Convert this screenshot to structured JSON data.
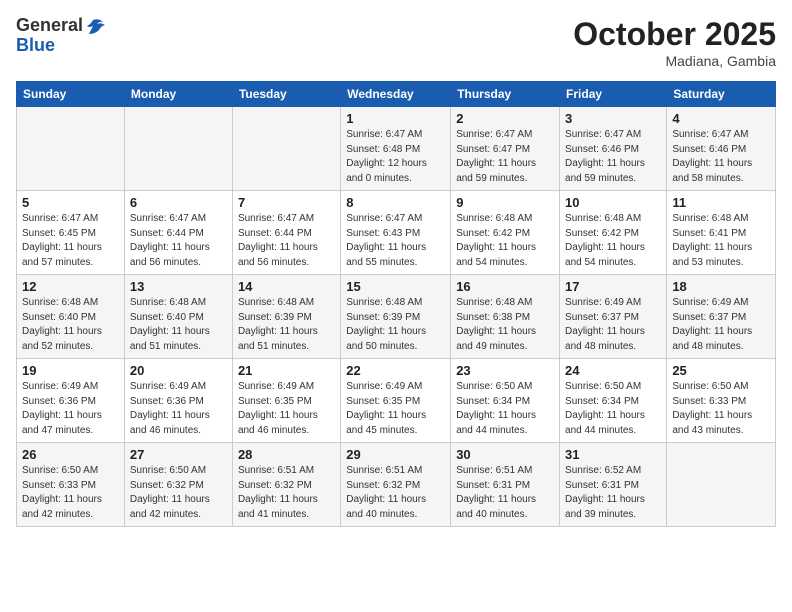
{
  "header": {
    "logo_general": "General",
    "logo_blue": "Blue",
    "month": "October 2025",
    "location": "Madiana, Gambia"
  },
  "days_of_week": [
    "Sunday",
    "Monday",
    "Tuesday",
    "Wednesday",
    "Thursday",
    "Friday",
    "Saturday"
  ],
  "weeks": [
    [
      {
        "day": "",
        "info": ""
      },
      {
        "day": "",
        "info": ""
      },
      {
        "day": "",
        "info": ""
      },
      {
        "day": "1",
        "info": "Sunrise: 6:47 AM\nSunset: 6:48 PM\nDaylight: 12 hours\nand 0 minutes."
      },
      {
        "day": "2",
        "info": "Sunrise: 6:47 AM\nSunset: 6:47 PM\nDaylight: 11 hours\nand 59 minutes."
      },
      {
        "day": "3",
        "info": "Sunrise: 6:47 AM\nSunset: 6:46 PM\nDaylight: 11 hours\nand 59 minutes."
      },
      {
        "day": "4",
        "info": "Sunrise: 6:47 AM\nSunset: 6:46 PM\nDaylight: 11 hours\nand 58 minutes."
      }
    ],
    [
      {
        "day": "5",
        "info": "Sunrise: 6:47 AM\nSunset: 6:45 PM\nDaylight: 11 hours\nand 57 minutes."
      },
      {
        "day": "6",
        "info": "Sunrise: 6:47 AM\nSunset: 6:44 PM\nDaylight: 11 hours\nand 56 minutes."
      },
      {
        "day": "7",
        "info": "Sunrise: 6:47 AM\nSunset: 6:44 PM\nDaylight: 11 hours\nand 56 minutes."
      },
      {
        "day": "8",
        "info": "Sunrise: 6:47 AM\nSunset: 6:43 PM\nDaylight: 11 hours\nand 55 minutes."
      },
      {
        "day": "9",
        "info": "Sunrise: 6:48 AM\nSunset: 6:42 PM\nDaylight: 11 hours\nand 54 minutes."
      },
      {
        "day": "10",
        "info": "Sunrise: 6:48 AM\nSunset: 6:42 PM\nDaylight: 11 hours\nand 54 minutes."
      },
      {
        "day": "11",
        "info": "Sunrise: 6:48 AM\nSunset: 6:41 PM\nDaylight: 11 hours\nand 53 minutes."
      }
    ],
    [
      {
        "day": "12",
        "info": "Sunrise: 6:48 AM\nSunset: 6:40 PM\nDaylight: 11 hours\nand 52 minutes."
      },
      {
        "day": "13",
        "info": "Sunrise: 6:48 AM\nSunset: 6:40 PM\nDaylight: 11 hours\nand 51 minutes."
      },
      {
        "day": "14",
        "info": "Sunrise: 6:48 AM\nSunset: 6:39 PM\nDaylight: 11 hours\nand 51 minutes."
      },
      {
        "day": "15",
        "info": "Sunrise: 6:48 AM\nSunset: 6:39 PM\nDaylight: 11 hours\nand 50 minutes."
      },
      {
        "day": "16",
        "info": "Sunrise: 6:48 AM\nSunset: 6:38 PM\nDaylight: 11 hours\nand 49 minutes."
      },
      {
        "day": "17",
        "info": "Sunrise: 6:49 AM\nSunset: 6:37 PM\nDaylight: 11 hours\nand 48 minutes."
      },
      {
        "day": "18",
        "info": "Sunrise: 6:49 AM\nSunset: 6:37 PM\nDaylight: 11 hours\nand 48 minutes."
      }
    ],
    [
      {
        "day": "19",
        "info": "Sunrise: 6:49 AM\nSunset: 6:36 PM\nDaylight: 11 hours\nand 47 minutes."
      },
      {
        "day": "20",
        "info": "Sunrise: 6:49 AM\nSunset: 6:36 PM\nDaylight: 11 hours\nand 46 minutes."
      },
      {
        "day": "21",
        "info": "Sunrise: 6:49 AM\nSunset: 6:35 PM\nDaylight: 11 hours\nand 46 minutes."
      },
      {
        "day": "22",
        "info": "Sunrise: 6:49 AM\nSunset: 6:35 PM\nDaylight: 11 hours\nand 45 minutes."
      },
      {
        "day": "23",
        "info": "Sunrise: 6:50 AM\nSunset: 6:34 PM\nDaylight: 11 hours\nand 44 minutes."
      },
      {
        "day": "24",
        "info": "Sunrise: 6:50 AM\nSunset: 6:34 PM\nDaylight: 11 hours\nand 44 minutes."
      },
      {
        "day": "25",
        "info": "Sunrise: 6:50 AM\nSunset: 6:33 PM\nDaylight: 11 hours\nand 43 minutes."
      }
    ],
    [
      {
        "day": "26",
        "info": "Sunrise: 6:50 AM\nSunset: 6:33 PM\nDaylight: 11 hours\nand 42 minutes."
      },
      {
        "day": "27",
        "info": "Sunrise: 6:50 AM\nSunset: 6:32 PM\nDaylight: 11 hours\nand 42 minutes."
      },
      {
        "day": "28",
        "info": "Sunrise: 6:51 AM\nSunset: 6:32 PM\nDaylight: 11 hours\nand 41 minutes."
      },
      {
        "day": "29",
        "info": "Sunrise: 6:51 AM\nSunset: 6:32 PM\nDaylight: 11 hours\nand 40 minutes."
      },
      {
        "day": "30",
        "info": "Sunrise: 6:51 AM\nSunset: 6:31 PM\nDaylight: 11 hours\nand 40 minutes."
      },
      {
        "day": "31",
        "info": "Sunrise: 6:52 AM\nSunset: 6:31 PM\nDaylight: 11 hours\nand 39 minutes."
      },
      {
        "day": "",
        "info": ""
      }
    ]
  ]
}
